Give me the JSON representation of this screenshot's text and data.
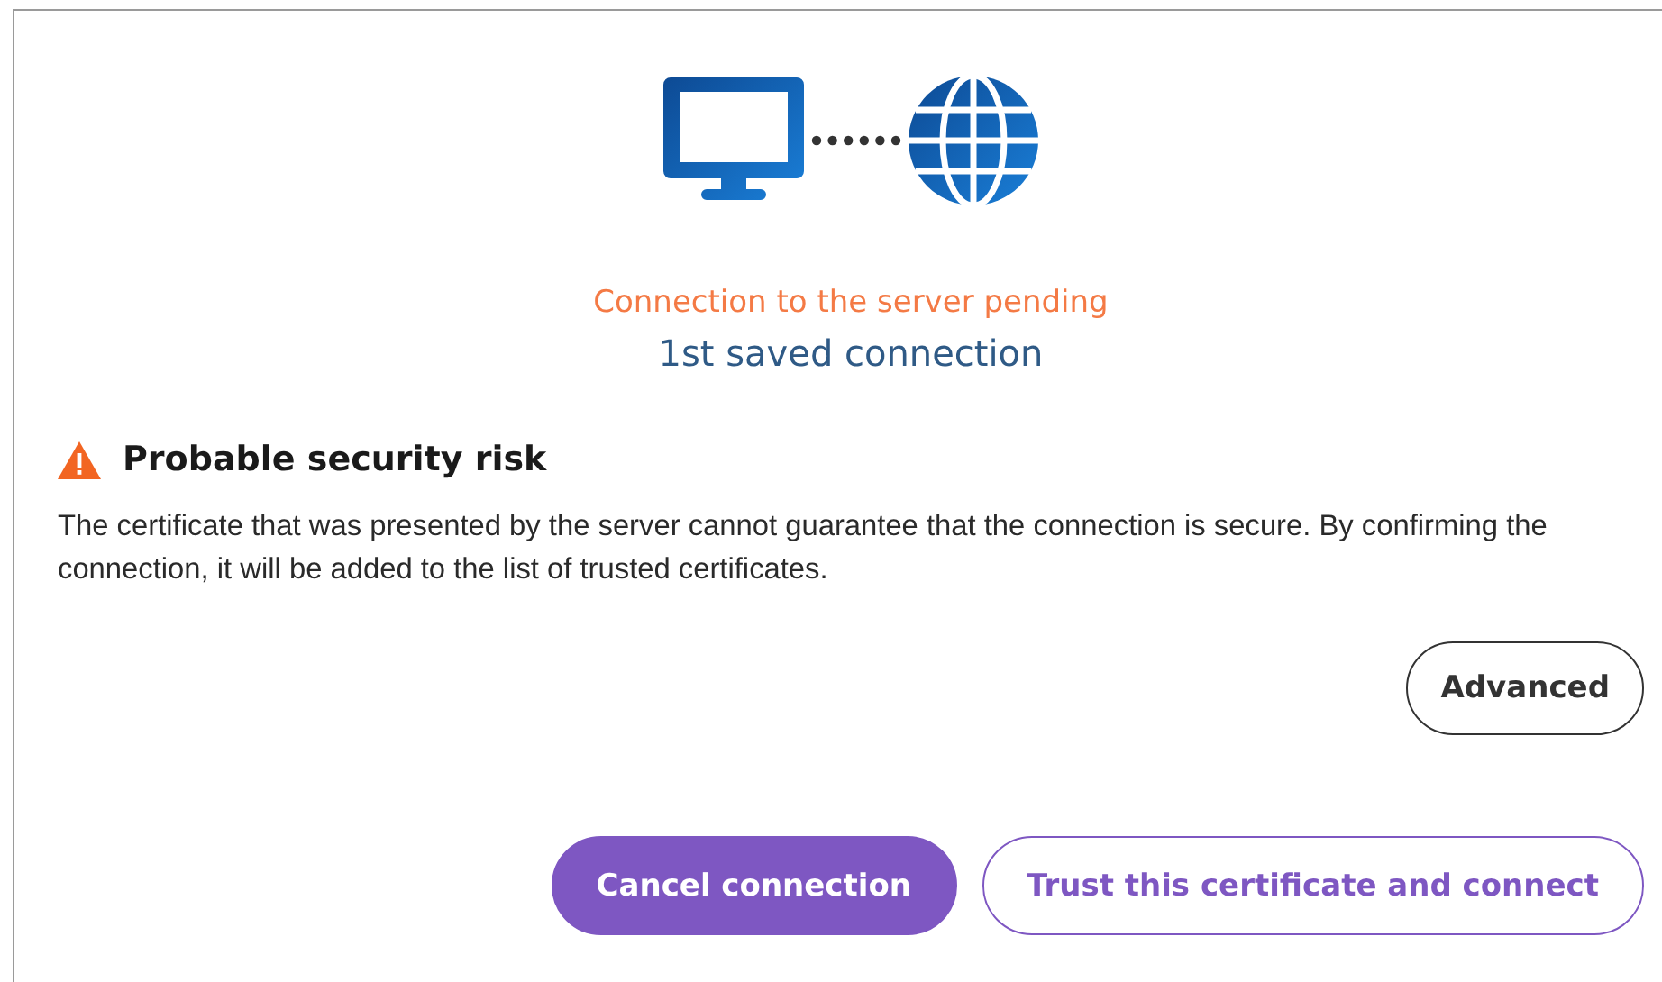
{
  "status": {
    "state": "Connection to the server pending",
    "connection": "1st saved connection"
  },
  "warning": {
    "title": "Probable security risk",
    "message": "The certificate that was presented by the server cannot guarantee that the connection is secure. By confirming the connection, it will be added to the list of trusted certificates."
  },
  "advanced_button": {
    "label": "Advanced"
  },
  "buttons": [
    {
      "label": "Cancel connection",
      "kind": "primary"
    },
    {
      "label": "Trust this certificate and connect",
      "kind": "outline"
    }
  ]
}
